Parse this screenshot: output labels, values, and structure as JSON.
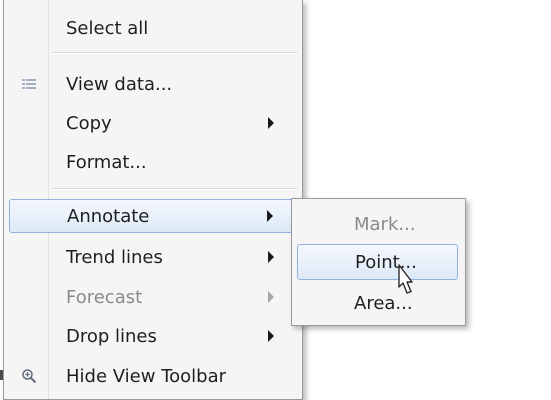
{
  "main_menu": {
    "select_all": "Select all",
    "view_data": "View data...",
    "copy": "Copy",
    "format": "Format...",
    "annotate": "Annotate",
    "trend_lines": "Trend lines",
    "forecast": "Forecast",
    "drop_lines": "Drop lines",
    "hide_view_toolbar": "Hide View Toolbar"
  },
  "annotate_submenu": {
    "mark": "Mark...",
    "point": "Point...",
    "area": "Area..."
  },
  "icons": {
    "view_data": "table-icon",
    "hide_view_toolbar": "zoom-icon",
    "cursor": "mouse-pointer-icon"
  },
  "colors": {
    "highlight_border": "#8fb2e0",
    "menu_background": "#f5f5f5",
    "disabled_text": "#8a8a8a"
  }
}
